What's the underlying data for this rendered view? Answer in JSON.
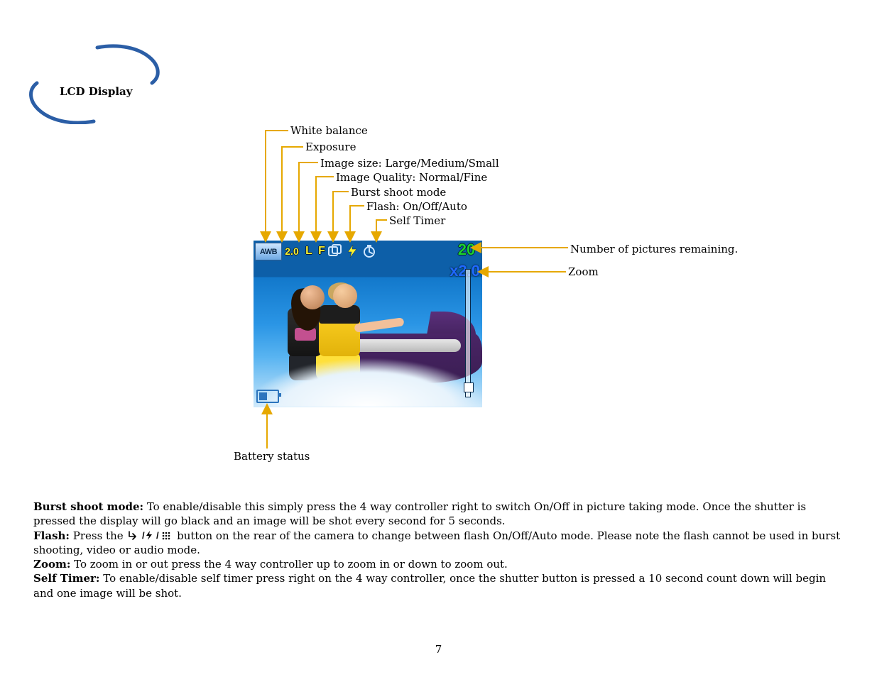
{
  "header": {
    "title": "LCD Display"
  },
  "callouts": {
    "white_balance": "White balance",
    "exposure": "Exposure",
    "image_size": "Image size: Large/Medium/Small",
    "image_quality": "Image Quality: Normal/Fine",
    "burst": "Burst shoot mode",
    "flash": "Flash: On/Off/Auto",
    "self_timer": "Self Timer",
    "pics_remaining": "Number of pictures remaining.",
    "zoom": "Zoom",
    "battery": "Battery status"
  },
  "lcd_hud": {
    "awb": "AWB",
    "exposure": "2.0",
    "size_letter": "L",
    "quality_letter": "F",
    "pictures_remaining": "20",
    "zoom_text": "x2.0"
  },
  "body": {
    "burst_label": "Burst shoot mode:",
    "burst_text": " To enable/disable this simply press the 4 way controller right to switch On/Off in picture taking mode. Once the shutter is pressed the display will go black and an image will be shot every second for 5 seconds.",
    "flash_label": "Flash:",
    "flash_pre": " Press the ",
    "flash_post": " button on the rear of the camera to change between flash On/Off/Auto mode. Please note the flash cannot be used in burst shooting, video or audio mode.",
    "zoom_label": "Zoom:",
    "zoom_text": "  To zoom in or out press the 4 way controller up to zoom in or down to zoom out.",
    "self_label": "Self Timer:",
    "self_text": " To enable/disable self timer press right on the 4 way controller, once the shutter button is pressed a 10 second count down will begin and one image will be shot."
  },
  "page_number": "7"
}
